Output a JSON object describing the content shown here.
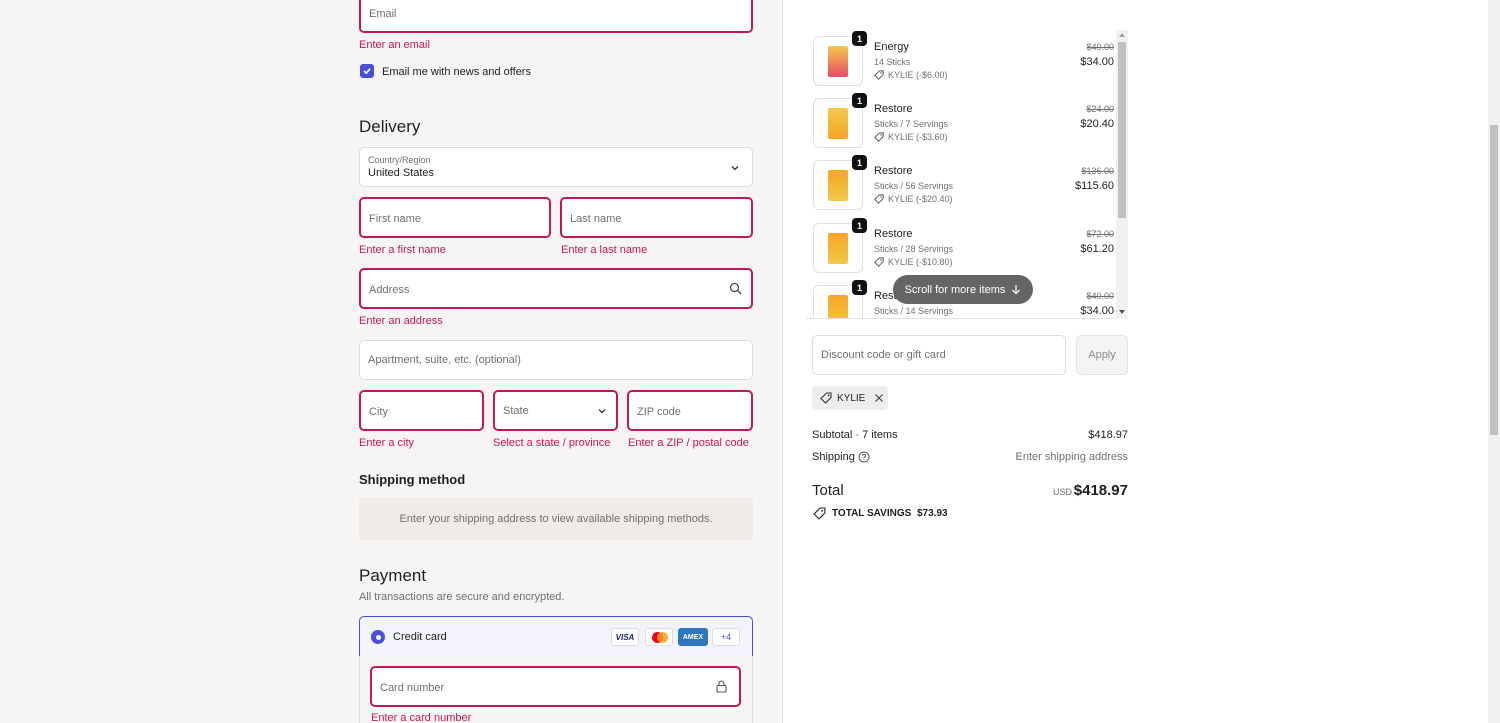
{
  "contact": {
    "email_placeholder": "Email",
    "email_error": "Enter an email",
    "newsletter_label": "Email me with news and offers",
    "newsletter_checked": true
  },
  "delivery": {
    "heading": "Delivery",
    "country_label": "Country/Region",
    "country_value": "United States",
    "first_name_placeholder": "First name",
    "first_name_error": "Enter a first name",
    "last_name_placeholder": "Last name",
    "last_name_error": "Enter a last name",
    "address_placeholder": "Address",
    "address_error": "Enter an address",
    "apartment_placeholder": "Apartment, suite, etc. (optional)",
    "city_placeholder": "City",
    "city_error": "Enter a city",
    "state_placeholder": "State",
    "state_error": "Select a state / province",
    "zip_placeholder": "ZIP code",
    "zip_error": "Enter a ZIP / postal code"
  },
  "shipping": {
    "heading": "Shipping method",
    "notice": "Enter your shipping address to view available shipping methods."
  },
  "payment": {
    "heading": "Payment",
    "subtitle": "All transactions are secure and encrypted.",
    "method_label": "Credit card",
    "card_brands": [
      "VISA",
      "MC",
      "AMEX"
    ],
    "more_brands": "+4",
    "card_number_placeholder": "Card number",
    "card_number_error": "Enter a card number"
  },
  "cart": {
    "items": [
      {
        "qty": "1",
        "name": "Energy",
        "desc": "14 Sticks",
        "discount": "KYLIE (-$6.00)",
        "old_price": "$40.00",
        "price": "$34.00"
      },
      {
        "qty": "1",
        "name": "Restore",
        "desc": "Sticks / 7 Servings",
        "discount": "KYLIE (-$3.60)",
        "old_price": "$24.00",
        "price": "$20.40"
      },
      {
        "qty": "1",
        "name": "Restore",
        "desc": "Sticks / 56 Servings",
        "discount": "KYLIE (-$20.40)",
        "old_price": "$136.00",
        "price": "$115.60"
      },
      {
        "qty": "1",
        "name": "Restore",
        "desc": "Sticks / 28 Servings",
        "discount": "KYLIE (-$10.80)",
        "old_price": "$72.00",
        "price": "$61.20"
      },
      {
        "qty": "1",
        "name": "Rest",
        "desc": "Sticks / 14 Servings",
        "discount": "",
        "old_price": "$40.00",
        "price": "$34.00"
      }
    ],
    "scroll_hint": "Scroll for more items",
    "discount_placeholder": "Discount code or gift card",
    "apply_label": "Apply",
    "applied_code": "KYLIE",
    "subtotal_label": "Subtotal · 7 items",
    "subtotal_value": "$418.97",
    "shipping_label": "Shipping",
    "shipping_value": "Enter shipping address",
    "total_label": "Total",
    "currency": "USD",
    "total_value": "$418.97",
    "savings_label": "TOTAL SAVINGS",
    "savings_value": "$73.93"
  },
  "colors": {
    "error": "#c2185b",
    "accent": "#4b4fd8",
    "panel_bg": "#f6f5f3"
  }
}
